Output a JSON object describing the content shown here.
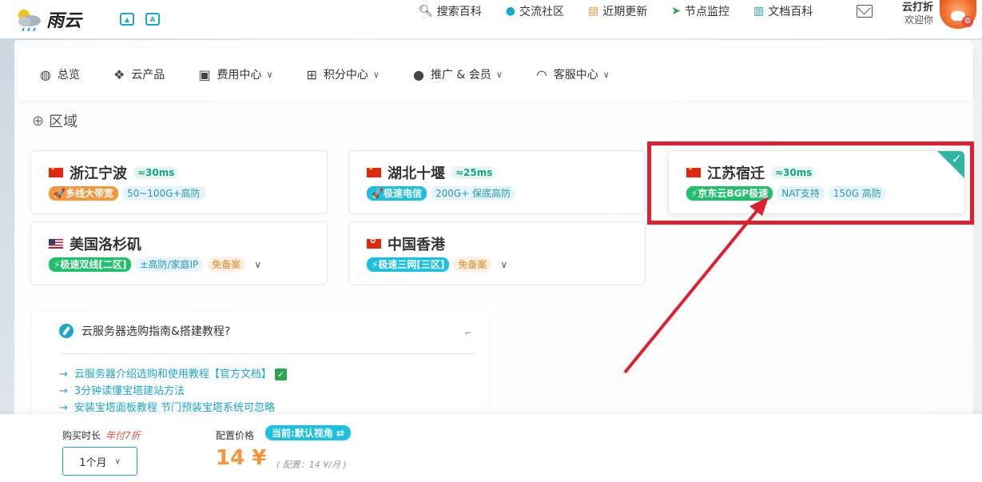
{
  "header": {
    "logo_text": "雨云",
    "nav": [
      {
        "icon": "search-icon",
        "label": "搜索百科"
      },
      {
        "icon": "qq-icon",
        "label": "交流社区"
      },
      {
        "icon": "news-icon",
        "label": "近期更新"
      },
      {
        "icon": "location-arrow-icon",
        "label": "节点监控"
      },
      {
        "icon": "book-icon",
        "label": "文档百科"
      }
    ],
    "user_name": "云打折",
    "user_greeting": "欢迎你"
  },
  "subnav": [
    {
      "icon": "dashboard-icon",
      "label": "总览",
      "dropdown": false
    },
    {
      "icon": "cubes-icon",
      "label": "云产品",
      "dropdown": false
    },
    {
      "icon": "money-icon",
      "label": "费用中心",
      "dropdown": true
    },
    {
      "icon": "gift-icon",
      "label": "积分中心",
      "dropdown": true
    },
    {
      "icon": "users-icon",
      "label": "推广 & 会员",
      "dropdown": true
    },
    {
      "icon": "headset-icon",
      "label": "客服中心",
      "dropdown": true
    }
  ],
  "region": {
    "title": "区域",
    "cards": [
      {
        "name": "浙江宁波",
        "flag": "cn",
        "ping": "≈30ms",
        "tags": [
          {
            "text": "🚀多线大带宽",
            "style": "orange"
          },
          {
            "text": "50~100G+高防",
            "style": "lightblue"
          }
        ],
        "more": false,
        "selected": false
      },
      {
        "name": "湖北十堰",
        "flag": "cn",
        "ping": "≈25ms",
        "tags": [
          {
            "text": "🚀极速电信",
            "style": "cyan"
          },
          {
            "text": "200G+ 保底高防",
            "style": "lightblue"
          }
        ],
        "more": false,
        "selected": false
      },
      {
        "name": "江苏宿迁",
        "flag": "cn",
        "ping": "≈30ms",
        "tags": [
          {
            "text": "⚡京东云BGP极速",
            "style": "green"
          },
          {
            "text": "NAT支持",
            "style": "lightblue"
          },
          {
            "text": "150G 高防",
            "style": "lightblue"
          }
        ],
        "more": false,
        "selected": true
      },
      {
        "name": "美国洛杉矶",
        "flag": "us",
        "ping": "",
        "tags": [
          {
            "text": "⚡极速双线[二区]",
            "style": "green"
          },
          {
            "text": "±高防/家庭IP",
            "style": "lightblue"
          },
          {
            "text": "免备案",
            "style": "lightorange"
          }
        ],
        "more": true,
        "selected": false
      },
      {
        "name": "中国香港",
        "flag": "hk",
        "ping": "",
        "tags": [
          {
            "text": "⚡极速三网[三区]",
            "style": "cyan"
          },
          {
            "text": "免备案",
            "style": "lightorange"
          }
        ],
        "more": true,
        "selected": false
      }
    ]
  },
  "guide": {
    "title": "云服务器选购指南&搭建教程?",
    "links": [
      {
        "text": "云服务器介绍选购和使用教程【官方文档】",
        "check": "✓"
      },
      {
        "text": "3分钟读懂宝塔建站方法",
        "check": ""
      },
      {
        "text": "安装宝塔面板教程  节门预装宝塔系统可忽略",
        "check": ""
      }
    ]
  },
  "bottom": {
    "period_label": "购买时长",
    "period_discount": "年付7折",
    "period_value": "1个月",
    "price_label": "配置价格",
    "view_badge": "当前:默认视角 ⇄",
    "price": "14 ¥",
    "price_sub": "( 配置：14 ¥/月 )"
  },
  "colors": {
    "accent": "#1ba7c9",
    "price": "#f7953a",
    "highlight": "#e02030",
    "selected_corner": "#2fb5a2"
  }
}
